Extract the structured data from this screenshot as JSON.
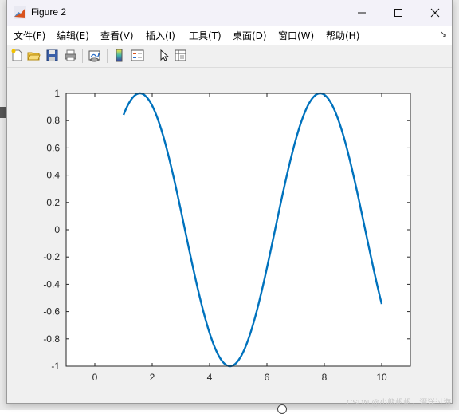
{
  "window": {
    "title": "Figure 2"
  },
  "menu": [
    {
      "label": "文件(F)",
      "name": "menu-file"
    },
    {
      "label": "编辑(E)",
      "name": "menu-edit"
    },
    {
      "label": "查看(V)",
      "name": "menu-view"
    },
    {
      "label": "插入(I)",
      "name": "menu-insert"
    },
    {
      "label": "工具(T)",
      "name": "menu-tools"
    },
    {
      "label": "桌面(D)",
      "name": "menu-desktop"
    },
    {
      "label": "窗口(W)",
      "name": "menu-window"
    },
    {
      "label": "帮助(H)",
      "name": "menu-help"
    }
  ],
  "toolbar": {
    "icons": [
      "new-figure-icon",
      "open-file-icon",
      "save-icon",
      "print-icon",
      "link-plot-icon",
      "colorbar-icon",
      "legend-icon",
      "pointer-icon",
      "property-inspector-icon"
    ]
  },
  "watermark": "CSDN @小熊帆帆，漂洋过海",
  "chart_data": {
    "type": "line",
    "function": "sin(x)",
    "x_range": [
      1,
      10
    ],
    "xlim": [
      -1,
      11
    ],
    "ylim": [
      -1,
      1
    ],
    "xticks": [
      "0",
      "2",
      "4",
      "6",
      "8",
      "10"
    ],
    "yticks": [
      "1",
      "0.8",
      "0.6",
      "0.4",
      "0.2",
      "0",
      "-0.2",
      "-0.4",
      "-0.6",
      "-0.8",
      "-1"
    ],
    "line_color": "#0072bd",
    "series": [
      {
        "x": [
          1,
          1.5,
          2,
          2.5,
          3,
          3.5,
          4,
          4.5,
          5,
          5.5,
          6,
          6.5,
          7,
          7.5,
          8,
          8.5,
          9,
          9.5,
          10
        ],
        "y": [
          0.84,
          1.0,
          0.91,
          0.6,
          0.14,
          -0.35,
          -0.76,
          -0.98,
          -0.96,
          -0.71,
          -0.28,
          0.22,
          0.66,
          0.94,
          0.99,
          0.8,
          0.41,
          -0.08,
          -0.54
        ]
      }
    ],
    "title": "",
    "xlabel": "",
    "ylabel": ""
  }
}
